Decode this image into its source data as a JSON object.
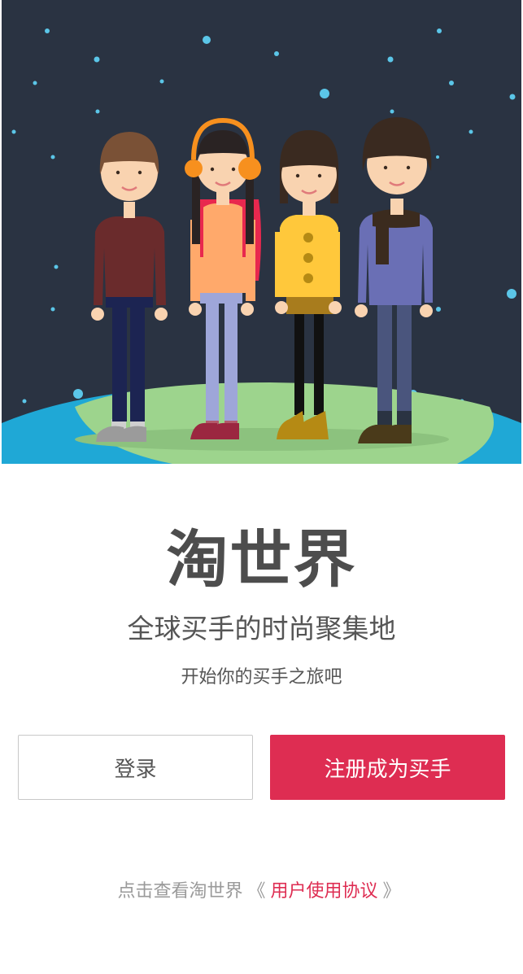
{
  "hero": {
    "illustration_desc_icon": "four-friends-illustration-icon",
    "colors": {
      "sky": "#2a3342",
      "star": "#5bc6e8",
      "ocean": "#1fa8d6",
      "land": "#9dd48d"
    }
  },
  "brand": {
    "title": "淘世界",
    "subtitle": "全球买手的时尚聚集地",
    "tagline": "开始你的买手之旅吧"
  },
  "actions": {
    "login_label": "登录",
    "register_label": "注册成为买手",
    "accent_color": "#de2d52"
  },
  "agreement": {
    "prefix": "点击查看淘世界",
    "open_bracket": "《",
    "link_text": "用户使用协议",
    "close_bracket": "》"
  }
}
